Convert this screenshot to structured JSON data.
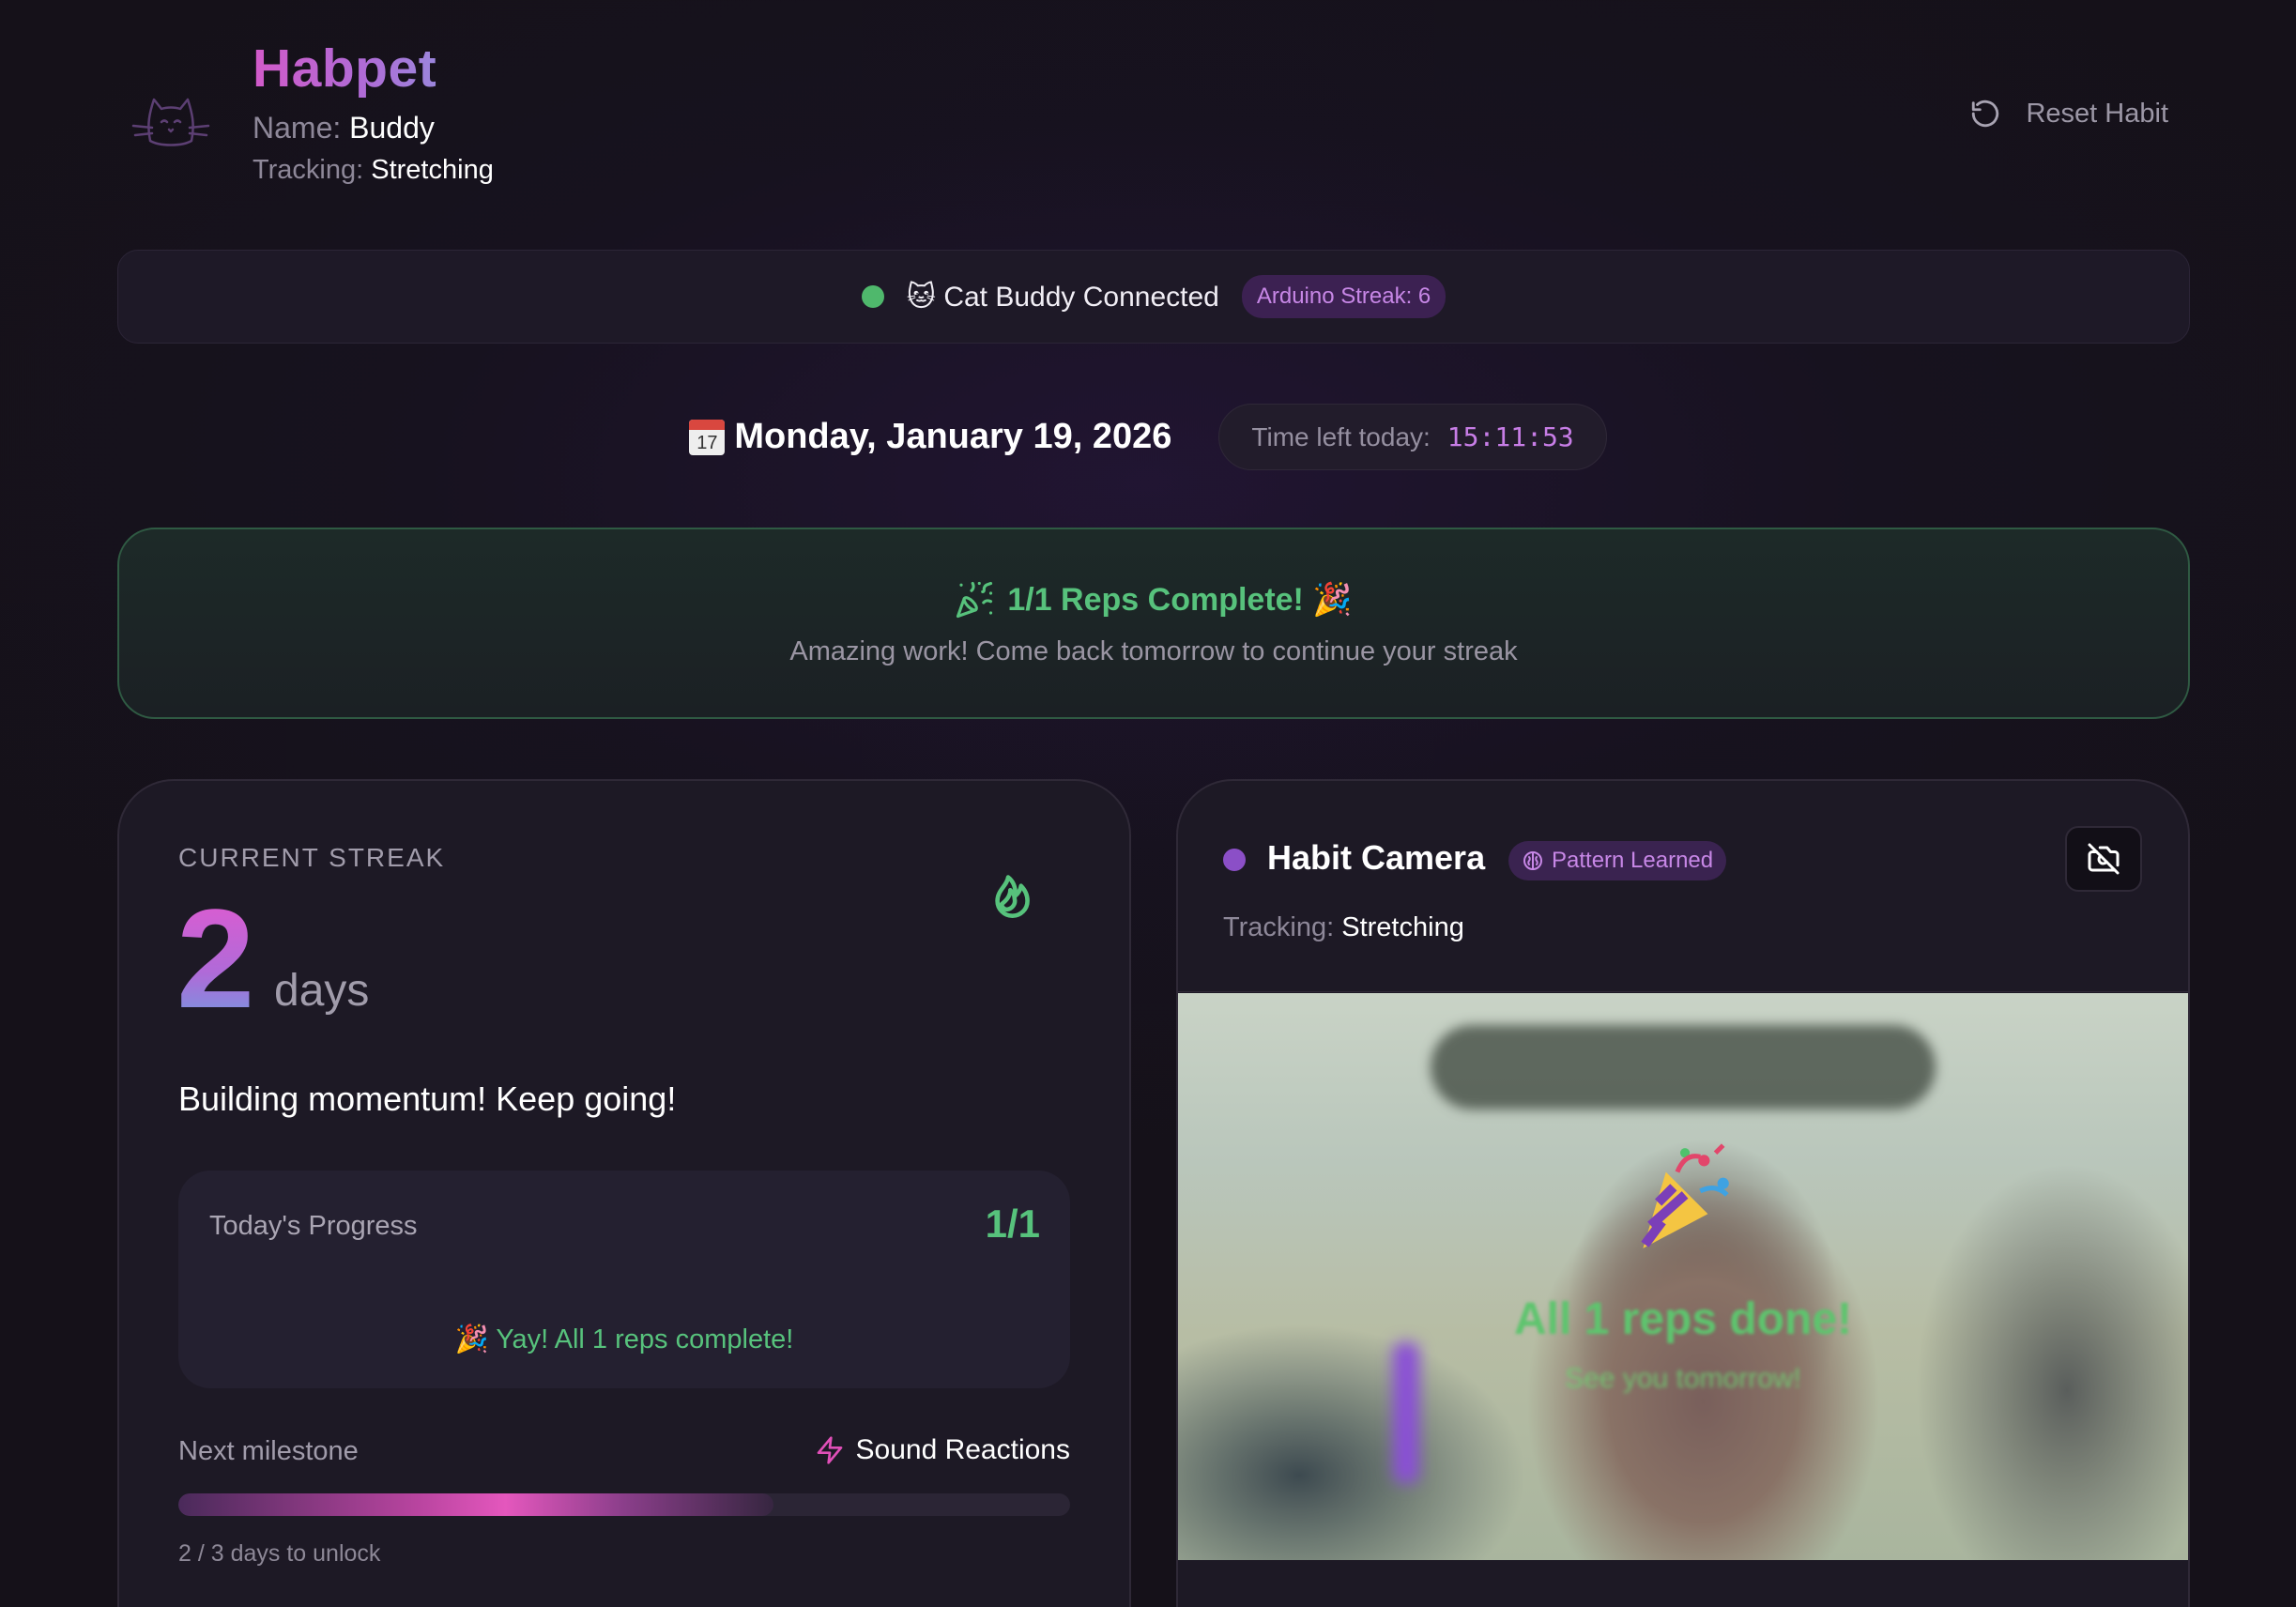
{
  "header": {
    "app_name": "Habpet",
    "name_label": "Name:",
    "name_value": "Buddy",
    "tracking_label": "Tracking:",
    "tracking_value": "Stretching",
    "reset_label": "Reset Habit"
  },
  "connection": {
    "status_text": "🐱 Cat Buddy Connected",
    "streak_badge": "Arduino Streak: 6",
    "status_color": "#4fb86c"
  },
  "date": {
    "calendar_day": "17",
    "text": "Monday, January 19, 2026",
    "time_left_label": "Time left today:",
    "time_left_value": "15:11:53"
  },
  "banner": {
    "title": "1/1 Reps Complete! 🎉",
    "subtitle": "Amazing work! Come back tomorrow to continue your streak"
  },
  "streak_card": {
    "label": "CURRENT STREAK",
    "value": "2",
    "unit": "days",
    "message": "Building momentum! Keep going!",
    "progress": {
      "label": "Today's Progress",
      "count": "1/1",
      "done_text": "🎉 Yay! All 1 reps complete!"
    },
    "milestone": {
      "label": "Next milestone",
      "reward": "Sound Reactions",
      "unlock_text": "2 / 3 days to unlock",
      "fraction": 0.667
    }
  },
  "camera_card": {
    "title": "Habit Camera",
    "badge": "Pattern Learned",
    "tracking_label": "Tracking:",
    "tracking_value": "Stretching",
    "overlay_title": "All 1 reps done!",
    "overlay_subtitle": "See you tomorrow!"
  },
  "colors": {
    "accent_pink": "#e25ad0",
    "accent_purple": "#c787e6",
    "success_green": "#57c27c"
  }
}
